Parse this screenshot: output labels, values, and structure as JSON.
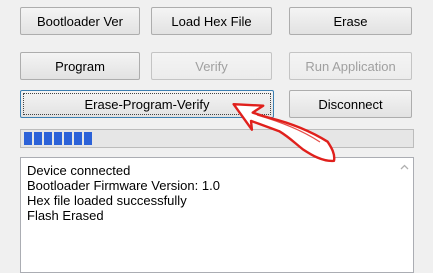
{
  "buttons": {
    "bootloader_ver": "Bootloader Ver",
    "load_hex_file": "Load Hex File",
    "erase": "Erase",
    "program": "Program",
    "verify": "Verify",
    "run_application": "Run Application",
    "erase_program_verify": "Erase-Program-Verify",
    "disconnect": "Disconnect"
  },
  "progress": {
    "filled_segments": 7,
    "total_segments": 37
  },
  "log": {
    "lines": [
      "Device connected",
      "Bootloader Firmware Version: 1.0",
      "Hex file loaded successfully",
      "Flash Erased"
    ]
  },
  "colors": {
    "progress_fill": "#2c62d8",
    "annotation_arrow": "#e0201c"
  },
  "icons": {
    "scroll_up": "chevron-up-icon",
    "annotation": "curved-arrow-icon"
  }
}
